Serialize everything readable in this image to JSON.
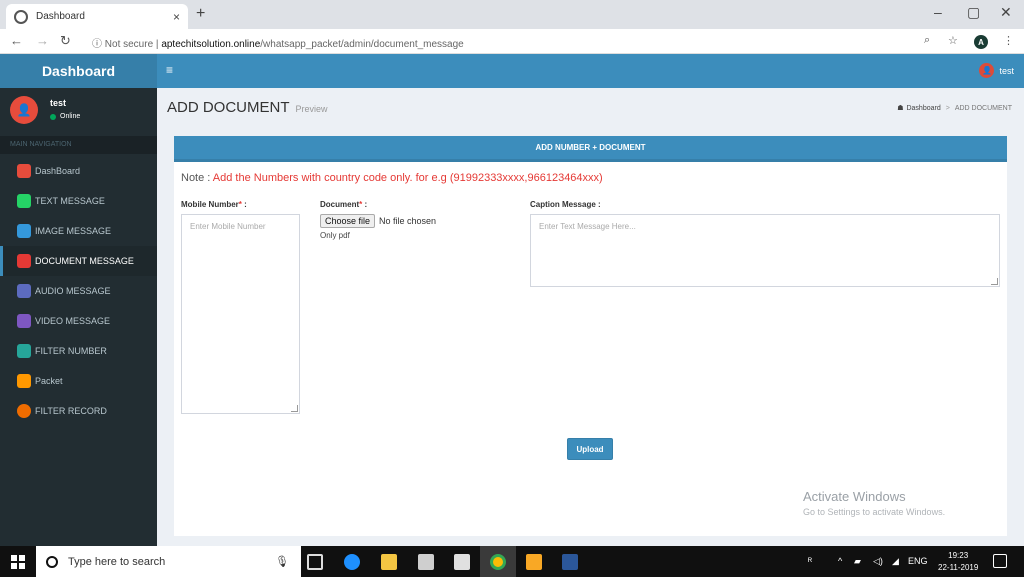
{
  "browser": {
    "tab_title": "Dashboard",
    "tab_close": "×",
    "new_tab": "+",
    "url_security": "Not secure",
    "url_domain": "aptechitsolution.online",
    "url_path": "/whatsapp_packet/admin/document_message",
    "profile_initial": "A"
  },
  "header": {
    "logo": "Dashboard",
    "toggle": "≡",
    "user_name": "test"
  },
  "sidebar": {
    "user_name": "test",
    "user_status": "Online",
    "nav_header": "MAIN NAVIGATION",
    "items": [
      {
        "label": "DashBoard",
        "color": "#e74c3c"
      },
      {
        "label": "TEXT MESSAGE",
        "color": "#25d366"
      },
      {
        "label": "IMAGE MESSAGE",
        "color": "#3498db"
      },
      {
        "label": "DOCUMENT MESSAGE",
        "color": "#e53935"
      },
      {
        "label": "AUDIO MESSAGE",
        "color": "#5c6bc0"
      },
      {
        "label": "VIDEO MESSAGE",
        "color": "#7e57c2"
      },
      {
        "label": "FILTER NUMBER",
        "color": "#26a69a"
      },
      {
        "label": "Packet",
        "color": "#ff9800"
      },
      {
        "label": "FILTER RECORD",
        "color": "#ef6c00"
      }
    ]
  },
  "page": {
    "title": "ADD DOCUMENT",
    "subtitle": "Preview",
    "breadcrumb_home": "Dashboard",
    "breadcrumb_sep": ">",
    "breadcrumb_current": "ADD DOCUMENT"
  },
  "form": {
    "box_title": "ADD NUMBER + DOCUMENT",
    "note_prefix": "Note : ",
    "note_text": "Add the Numbers with country code only. for e.g (91992333xxxx,966123464xxx)",
    "mobile_label": "Mobile Number",
    "mobile_placeholder": "Enter Mobile Number",
    "document_label": "Document",
    "choose_file": "Choose file",
    "no_file": "No file chosen",
    "document_hint": "Only pdf",
    "caption_label": "Caption Message :",
    "caption_placeholder": "Enter Text Message Here...",
    "required_mark": "*",
    "label_colon": " :",
    "upload": "Upload"
  },
  "watermark": {
    "title": "Activate Windows",
    "sub": "Go to Settings to activate Windows."
  },
  "taskbar": {
    "search_placeholder": "Type here to search",
    "lang": "ENG",
    "time": "19:23",
    "date": "22-11-2019"
  }
}
